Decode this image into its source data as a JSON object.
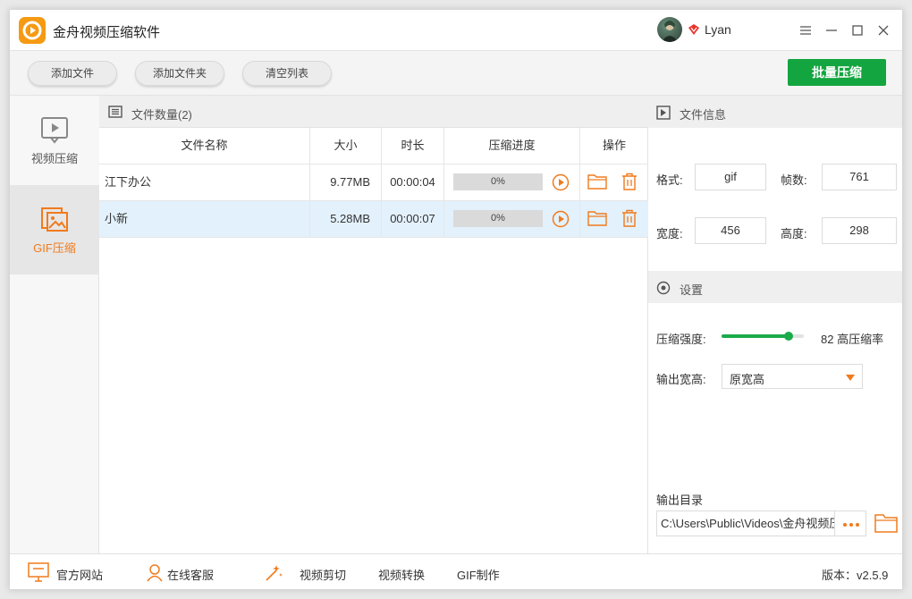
{
  "app": {
    "title": "金舟视频压缩软件"
  },
  "user": {
    "name": "Lyan"
  },
  "toolbar": {
    "add_file": "添加文件",
    "add_folder": "添加文件夹",
    "clear_list": "清空列表",
    "batch_compress": "批量压缩"
  },
  "nav": {
    "items": [
      {
        "label": "视频压缩",
        "icon": "video-play-icon",
        "active": false
      },
      {
        "label": "GIF压缩",
        "icon": "image-icon",
        "active": true
      }
    ]
  },
  "file_list": {
    "count_label": "文件数量(2)",
    "columns": [
      "文件名称",
      "大小",
      "时长",
      "压缩进度",
      "操作"
    ],
    "rows": [
      {
        "name": "江下办公",
        "size": "9.77MB",
        "duration": "00:00:04",
        "progress": "0%",
        "progress_value": 0,
        "selected": false
      },
      {
        "name": "小新",
        "size": "5.28MB",
        "duration": "00:00:07",
        "progress": "0%",
        "progress_value": 0,
        "selected": true
      }
    ]
  },
  "file_info": {
    "title": "文件信息",
    "format_label": "格式:",
    "format_value": "gif",
    "frames_label": "帧数:",
    "frames_value": "761",
    "width_label": "宽度:",
    "width_value": "456",
    "height_label": "高度:",
    "height_value": "298"
  },
  "settings": {
    "title": "设置",
    "strength_label": "压缩强度:",
    "strength_value": 82,
    "strength_text": "82 高压缩率",
    "output_size_label": "输出宽高:",
    "output_size_value": "原宽高",
    "output_dir_label": "输出目录",
    "output_dir_value": "C:\\Users\\Public\\Videos\\金舟视频压缩软件"
  },
  "footer": {
    "website": "官方网站",
    "support": "在线客服",
    "video_cut": "视频剪切",
    "video_convert": "视频转换",
    "gif_make": "GIF制作",
    "version": "版本：v2.5.9"
  },
  "colors": {
    "accent_green": "#13a53f",
    "accent_orange": "#f07b1d",
    "logo_orange": "#f59a12",
    "selected_row": "#e3f1fc"
  }
}
